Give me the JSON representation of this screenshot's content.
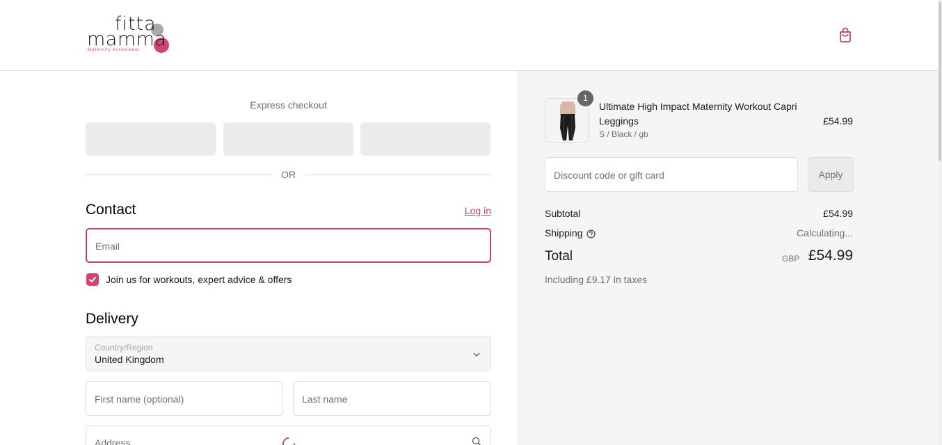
{
  "header": {
    "logo_line1": "fitta",
    "logo_line2": "mamma",
    "logo_tagline": "Maternity Activewear"
  },
  "express": {
    "title": "Express checkout",
    "divider": "OR"
  },
  "contact": {
    "title": "Contact",
    "login_link": "Log in",
    "email_placeholder": "Email",
    "marketing_label": "Join us for workouts, expert advice & offers",
    "marketing_checked": true
  },
  "delivery": {
    "title": "Delivery",
    "country_label": "Country/Region",
    "country_value": "United Kingdom",
    "first_name_placeholder": "First name (optional)",
    "last_name_placeholder": "Last name",
    "address_placeholder": "Address"
  },
  "summary": {
    "item": {
      "quantity": "1",
      "title": "Ultimate High Impact Maternity Workout Capri Leggings",
      "variant": "S / Black / gb",
      "price": "£54.99"
    },
    "discount_placeholder": "Discount code or gift card",
    "apply_label": "Apply",
    "subtotal_label": "Subtotal",
    "subtotal_value": "£54.99",
    "shipping_label": "Shipping",
    "shipping_value": "Calculating...",
    "total_label": "Total",
    "currency": "GBP",
    "total_value": "£54.99",
    "taxes_note": "Including £9.17 in taxes"
  },
  "colors": {
    "accent": "#c2406a",
    "brand_pink": "#d2466c",
    "panel_bg": "#f5f5f5"
  }
}
